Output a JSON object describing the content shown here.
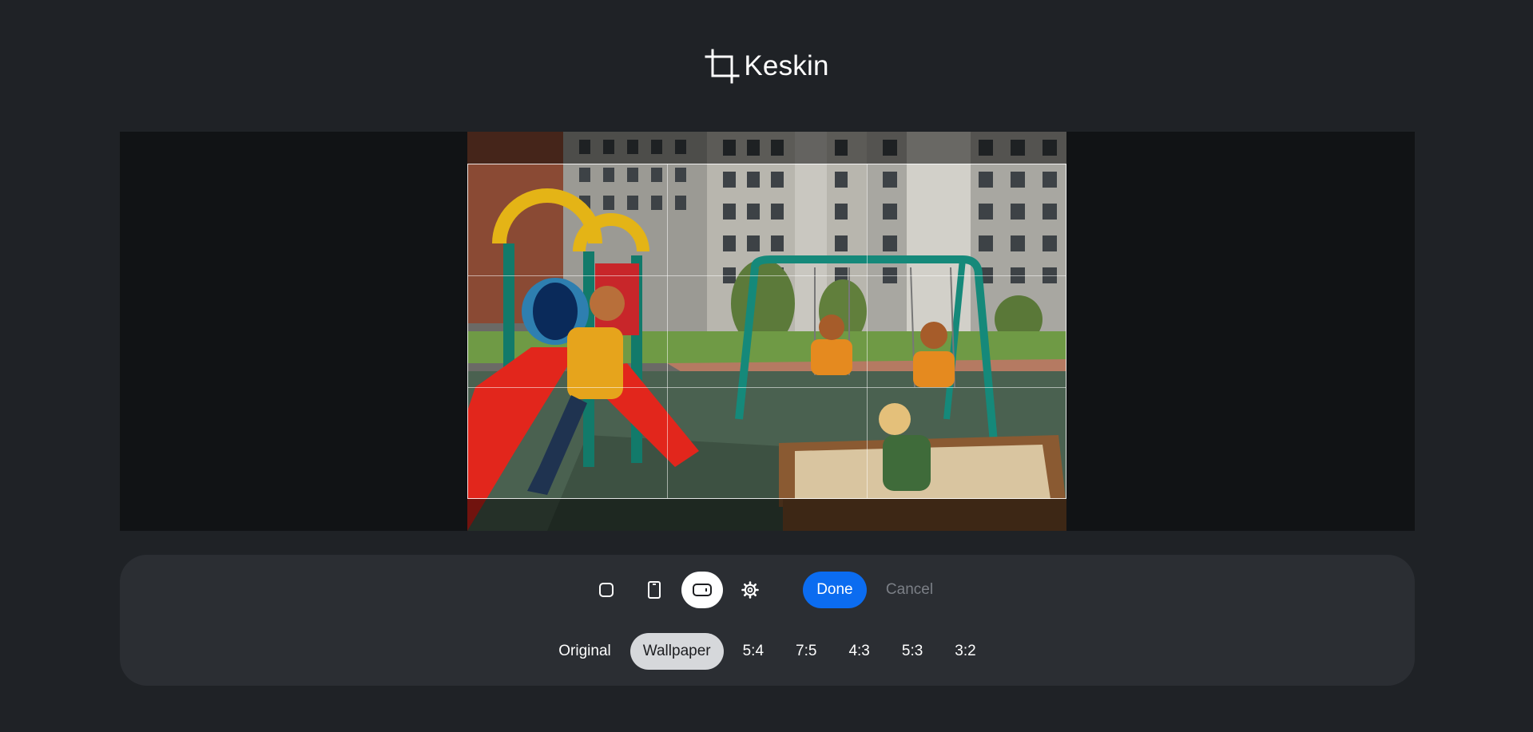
{
  "app": {
    "name": "Keskin",
    "logo_icon": "crop-icon"
  },
  "image": {
    "description_icon": "photo-image"
  },
  "toolbar": {
    "tools": [
      {
        "name": "square-icon",
        "active": false
      },
      {
        "name": "portrait-icon",
        "active": false
      },
      {
        "name": "landscape-icon",
        "active": true
      },
      {
        "name": "gear-icon",
        "active": false
      }
    ],
    "done_label": "Done",
    "cancel_label": "Cancel"
  },
  "ratios": [
    {
      "label": "Original",
      "active": false
    },
    {
      "label": "Wallpaper",
      "active": true
    },
    {
      "label": "5:4",
      "active": false
    },
    {
      "label": "7:5",
      "active": false
    },
    {
      "label": "4:3",
      "active": false
    },
    {
      "label": "5:3",
      "active": false
    },
    {
      "label": "3:2",
      "active": false
    }
  ],
  "colors": {
    "background": "#1f2226",
    "panel": "#2b2e33",
    "accent": "#0b6cf0",
    "active_ratio": "#d6d8db"
  }
}
